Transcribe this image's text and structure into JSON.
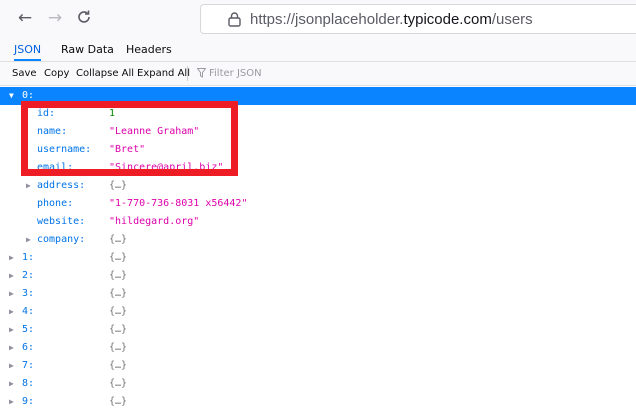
{
  "browser": {
    "url_prefix": "https://jsonplaceholder.",
    "url_domain": "typicode.com",
    "url_path": "/users"
  },
  "viewer": {
    "tabs": [
      "JSON",
      "Raw Data",
      "Headers"
    ],
    "active_tab": "JSON",
    "toolbar": {
      "save": "Save",
      "copy": "Copy",
      "collapse_all": "Collapse All",
      "expand_all": "Expand All",
      "filter_placeholder": "Filter JSON"
    }
  },
  "tree": {
    "root_key": "0:",
    "fields": [
      {
        "key": "id:",
        "value": "1",
        "type": "number"
      },
      {
        "key": "name:",
        "value": "\"Leanne Graham\"",
        "type": "string"
      },
      {
        "key": "username:",
        "value": "\"Bret\"",
        "type": "string"
      },
      {
        "key": "email:",
        "value": "\"Sincere@april.biz\"",
        "type": "string"
      },
      {
        "key": "address:",
        "value": "{…}",
        "type": "object"
      },
      {
        "key": "phone:",
        "value": "\"1-770-736-8031 x56442\"",
        "type": "string"
      },
      {
        "key": "website:",
        "value": "\"hildegard.org\"",
        "type": "string"
      },
      {
        "key": "company:",
        "value": "{…}",
        "type": "object"
      }
    ],
    "collapsed": [
      {
        "key": "1:",
        "value": "{…}"
      },
      {
        "key": "2:",
        "value": "{…}"
      },
      {
        "key": "3:",
        "value": "{…}"
      },
      {
        "key": "4:",
        "value": "{…}"
      },
      {
        "key": "5:",
        "value": "{…}"
      },
      {
        "key": "6:",
        "value": "{…}"
      },
      {
        "key": "7:",
        "value": "{…}"
      },
      {
        "key": "8:",
        "value": "{…}"
      },
      {
        "key": "9:",
        "value": "{…}"
      }
    ]
  }
}
